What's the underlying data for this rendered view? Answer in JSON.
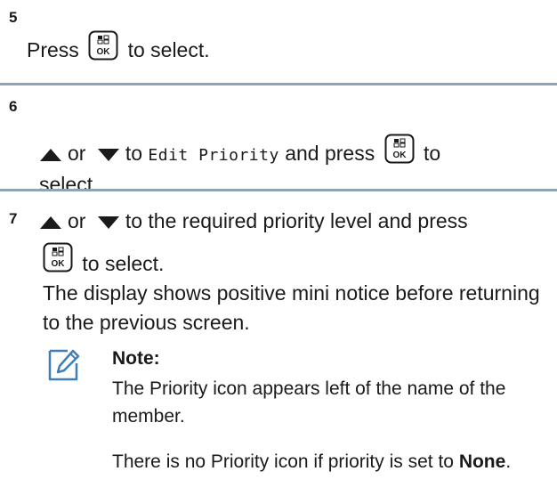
{
  "steps": [
    {
      "number": "5",
      "before": "Press",
      "after": "to select."
    },
    {
      "number": "6",
      "or": "or",
      "to": "to",
      "menu_item": "Edit Priority",
      "and_press": "and press",
      "to_tail": "to",
      "select_tail": "select."
    },
    {
      "number": "7",
      "or": "or",
      "text": "to the required priority level and press",
      "to_select": "to select.",
      "result": "The display shows positive mini notice before returning to the previous screen."
    }
  ],
  "note": {
    "heading": "Note:",
    "para1": "The Priority icon appears left of the name of the member.",
    "para2_before": "There is no Priority icon if priority is set to",
    "para2_bold": "None",
    "para2_after": "."
  },
  "icons": {
    "ok_button": "ok-menu-button-icon",
    "up_arrow": "up-arrow-icon",
    "down_arrow": "down-arrow-icon",
    "note": "note-pencil-icon"
  },
  "colors": {
    "rule": "#8fa5b3",
    "note_icon": "#3f7fb8"
  }
}
